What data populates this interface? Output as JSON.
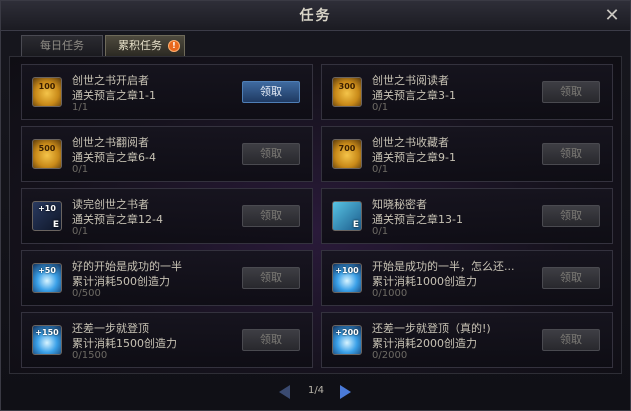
{
  "window": {
    "title": "任务",
    "close_label": "✕"
  },
  "tabs": [
    {
      "label": "每日任务",
      "active": false
    },
    {
      "label": "累积任务",
      "active": true,
      "badge": "!"
    }
  ],
  "quests": [
    {
      "icon": "coin",
      "icon_text": "100",
      "name": "创世之书开启者",
      "desc": "通关预言之章1-1",
      "progress": "1/1",
      "button": "领取",
      "enabled": true
    },
    {
      "icon": "coin",
      "icon_text": "300",
      "name": "创世之书阅读者",
      "desc": "通关预言之章3-1",
      "progress": "0/1",
      "button": "领取",
      "enabled": false
    },
    {
      "icon": "coin",
      "icon_text": "500",
      "name": "创世之书翻阅者",
      "desc": "通关预言之章6-4",
      "progress": "0/1",
      "button": "领取",
      "enabled": false
    },
    {
      "icon": "coin",
      "icon_text": "700",
      "name": "创世之书收藏者",
      "desc": "通关预言之章9-1",
      "progress": "0/1",
      "button": "领取",
      "enabled": false
    },
    {
      "icon": "book",
      "icon_text": "+10",
      "icon_letter": "E",
      "name": "读完创世之书者",
      "desc": "通关预言之章12-4",
      "progress": "0/1",
      "button": "领取",
      "enabled": false
    },
    {
      "icon": "card",
      "icon_text": "",
      "icon_letter": "E",
      "name": "知晓秘密者",
      "desc": "通关预言之章13-1",
      "progress": "0/1",
      "button": "领取",
      "enabled": false
    },
    {
      "icon": "orb",
      "icon_text": "+50",
      "name": "好的开始是成功的一半",
      "desc": "累计消耗500创造力",
      "progress": "0/500",
      "button": "领取",
      "enabled": false
    },
    {
      "icon": "orb",
      "icon_text": "+100",
      "name": "开始是成功的一半，怎么还...",
      "desc": "累计消耗1000创造力",
      "progress": "0/1000",
      "button": "领取",
      "enabled": false
    },
    {
      "icon": "orb",
      "icon_text": "+150",
      "name": "还差一步就登顶",
      "desc": "累计消耗1500创造力",
      "progress": "0/1500",
      "button": "领取",
      "enabled": false
    },
    {
      "icon": "orb",
      "icon_text": "+200",
      "name": "还差一步就登顶（真的!)",
      "desc": "累计消耗2000创造力",
      "progress": "0/2000",
      "button": "领取",
      "enabled": false
    }
  ],
  "pager": {
    "label": "1/4",
    "current": 1,
    "total": 4
  }
}
